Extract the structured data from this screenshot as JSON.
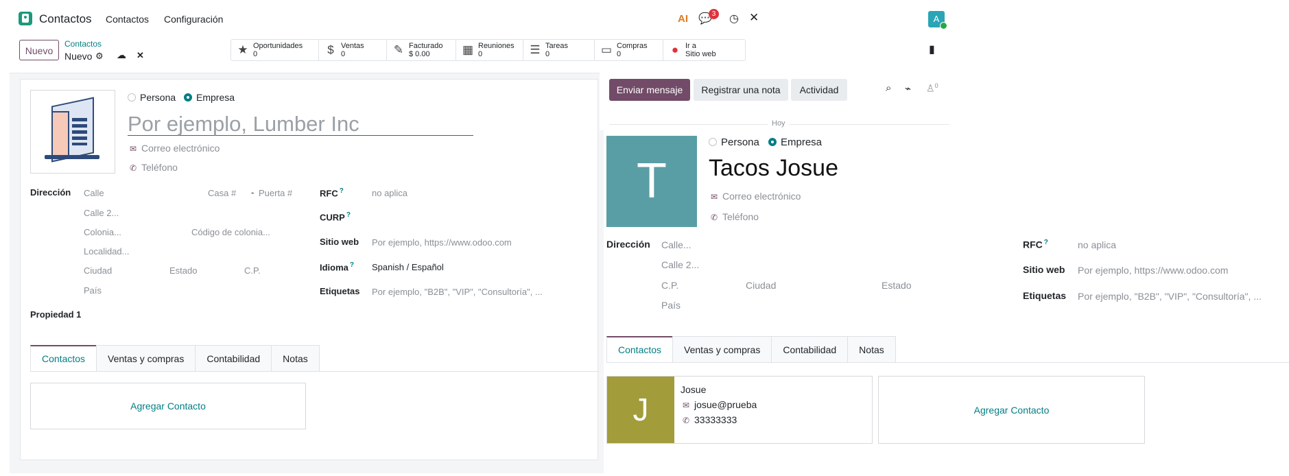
{
  "navbar": {
    "app_title": "Contactos",
    "menu": [
      "Contactos",
      "Configuración"
    ],
    "ai_label": "AI",
    "messages_badge": "3",
    "avatar_letter": "A"
  },
  "control": {
    "new_button": "Nuevo",
    "breadcrumb_parent": "Contactos",
    "breadcrumb_current": "Nuevo",
    "smart_buttons": [
      {
        "icon": "star-icon",
        "label": "Oportunidades",
        "value": "0"
      },
      {
        "icon": "dollar-icon",
        "label": "Ventas",
        "value": "0"
      },
      {
        "icon": "invoice-icon",
        "label": "Facturado",
        "value": "$ 0.00"
      },
      {
        "icon": "calendar-icon",
        "label": "Reuniones",
        "value": "0"
      },
      {
        "icon": "tasks-icon",
        "label": "Tareas",
        "value": "0"
      },
      {
        "icon": "card-icon",
        "label": "Compras",
        "value": "0"
      },
      {
        "icon": "globe-icon",
        "label": "Ir a",
        "value": "Sitio web"
      }
    ]
  },
  "form_left": {
    "type_person": "Persona",
    "type_company": "Empresa",
    "name_placeholder": "Por ejemplo, Lumber Inc",
    "email_placeholder": "Correo electrónico",
    "phone_placeholder": "Teléfono",
    "address_label": "Dirección",
    "street": "Calle",
    "house": "Casa #",
    "door": "Puerta #",
    "street2": "Calle 2...",
    "colony": "Colonia...",
    "colony_code": "Código de colonia...",
    "locality": "Localidad...",
    "city": "Ciudad",
    "state": "Estado",
    "zip": "C.P.",
    "country": "País",
    "property": "Propiedad 1",
    "rfc_label": "RFC",
    "rfc_value": "no aplica",
    "curp_label": "CURP",
    "website_label": "Sitio web",
    "website_placeholder": "Por ejemplo, https://www.odoo.com",
    "lang_label": "Idioma",
    "lang_value": "Spanish / Español",
    "tags_label": "Etiquetas",
    "tags_placeholder": "Por ejemplo, \"B2B\", \"VIP\", \"Consultoría\", ...",
    "tabs": [
      "Contactos",
      "Ventas y compras",
      "Contabilidad",
      "Notas"
    ],
    "add_contact": "Agregar Contacto"
  },
  "chatter": {
    "send_message": "Enviar mensaje",
    "log_note": "Registrar una nota",
    "activity": "Actividad",
    "followers": "0",
    "today": "Hoy"
  },
  "form_right": {
    "avatar_letter": "T",
    "avatar_color": "#5a9ea5",
    "type_person": "Persona",
    "type_company": "Empresa",
    "name": "Tacos Josue",
    "email_placeholder": "Correo electrónico",
    "phone_placeholder": "Teléfono",
    "address_label": "Dirección",
    "street": "Calle...",
    "street2": "Calle 2...",
    "zip": "C.P.",
    "city": "Ciudad",
    "state": "Estado",
    "country": "País",
    "rfc_label": "RFC",
    "rfc_value": "no aplica",
    "website_label": "Sitio web",
    "website_placeholder": "Por ejemplo, https://www.odoo.com",
    "tags_label": "Etiquetas",
    "tags_placeholder": "Por ejemplo, \"B2B\", \"VIP\", \"Consultoría\", ...",
    "tabs": [
      "Contactos",
      "Ventas y compras",
      "Contabilidad",
      "Notas"
    ],
    "contact_card": {
      "letter": "J",
      "color": "#a29c3a",
      "name": "Josue",
      "email": "josue@prueba",
      "phone": "33333333"
    },
    "add_contact": "Agregar Contacto"
  }
}
